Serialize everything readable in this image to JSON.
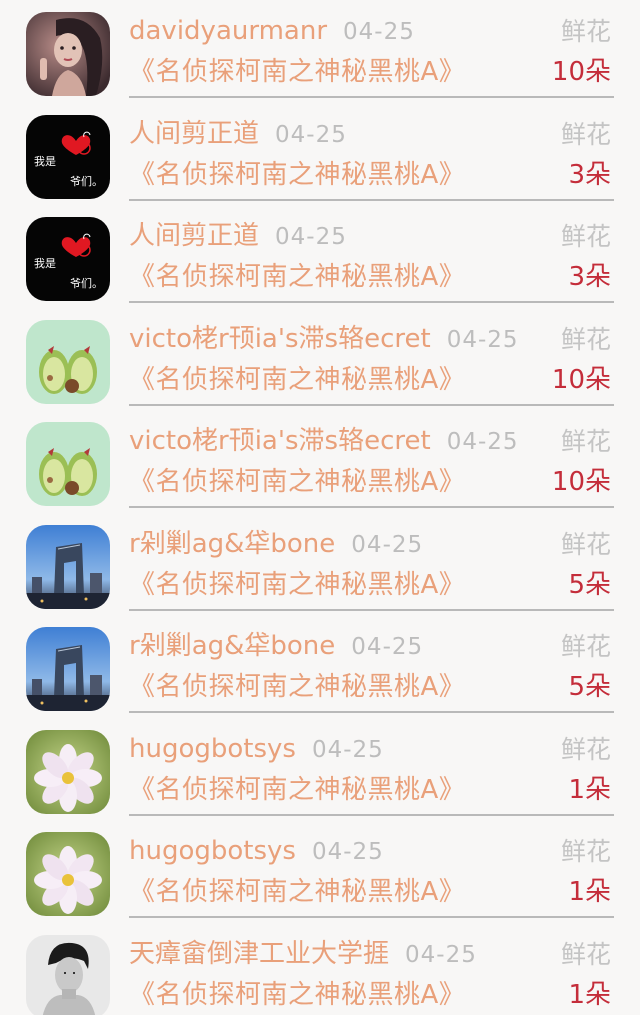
{
  "records": [
    {
      "avatar_icon": "girl-portrait-avatar",
      "name": "davidyaurmanr",
      "date": "04-25",
      "gift": "鲜花",
      "title": "《名侦探柯南之神秘黑桃A》",
      "count": "10朵"
    },
    {
      "avatar_icon": "black-hearts-avatar",
      "name": "人间剪正道",
      "date": "04-25",
      "gift": "鲜花",
      "title": "《名侦探柯南之神秘黑桃A》",
      "count": "3朵",
      "avatar_text_1": "我是",
      "avatar_text_2": "爷们。"
    },
    {
      "avatar_icon": "black-hearts-avatar",
      "name": "人间剪正道",
      "date": "04-25",
      "gift": "鲜花",
      "title": "《名侦探柯南之神秘黑桃A》",
      "count": "3朵",
      "avatar_text_1": "我是",
      "avatar_text_2": "爷们。"
    },
    {
      "avatar_icon": "avocado-avatar",
      "name": "victo栳r顸ia's滞s辂ecret",
      "date": "04-25",
      "gift": "鲜花",
      "title": "《名侦探柯南之神秘黑桃A》",
      "count": "10朵"
    },
    {
      "avatar_icon": "avocado-avatar",
      "name": "victo栳r顸ia's滞s辂ecret",
      "date": "04-25",
      "gift": "鲜花",
      "title": "《名侦探柯南之神秘黑桃A》",
      "count": "10朵"
    },
    {
      "avatar_icon": "city-building-avatar",
      "name": "r剁剿ag&牮bone",
      "date": "04-25",
      "gift": "鲜花",
      "title": "《名侦探柯南之神秘黑桃A》",
      "count": "5朵"
    },
    {
      "avatar_icon": "city-building-avatar",
      "name": "r剁剿ag&牮bone",
      "date": "04-25",
      "gift": "鲜花",
      "title": "《名侦探柯南之神秘黑桃A》",
      "count": "5朵"
    },
    {
      "avatar_icon": "flower-avatar",
      "name": "hugogbotsys",
      "date": "04-25",
      "gift": "鲜花",
      "title": "《名侦探柯南之神秘黑桃A》",
      "count": "1朵"
    },
    {
      "avatar_icon": "flower-avatar",
      "name": "hugogbotsys",
      "date": "04-25",
      "gift": "鲜花",
      "title": "《名侦探柯南之神秘黑桃A》",
      "count": "1朵"
    },
    {
      "avatar_icon": "man-portrait-avatar",
      "name": "天瘴畲倒津工业大学捱",
      "date": "04-25",
      "gift": "鲜花",
      "title": "《名侦探柯南之神秘黑桃A》",
      "count": "1朵"
    }
  ]
}
